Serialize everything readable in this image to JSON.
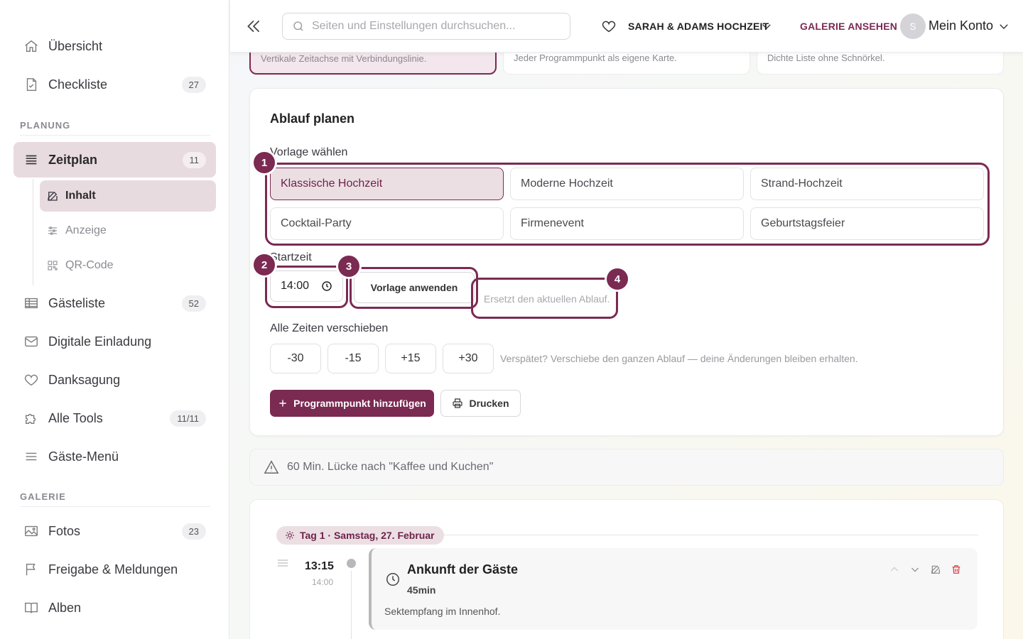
{
  "sidebar": {
    "items_top": [
      {
        "label": "Übersicht",
        "icon": "home-icon"
      },
      {
        "label": "Checkliste",
        "icon": "document-check-icon",
        "count": "27"
      }
    ],
    "section_planung": "PLANUNG",
    "zeitplan": {
      "label": "Zeitplan",
      "icon": "list-icon",
      "count": "11"
    },
    "sub_items": [
      {
        "label": "Inhalt",
        "icon": "edit-icon"
      },
      {
        "label": "Anzeige",
        "icon": "sliders-icon"
      },
      {
        "label": "QR-Code",
        "icon": "qr-code-icon"
      }
    ],
    "items_planung": [
      {
        "label": "Gästeliste",
        "icon": "table-icon",
        "count": "52"
      },
      {
        "label": "Digitale Einladung",
        "icon": "mail-icon"
      },
      {
        "label": "Danksagung",
        "icon": "heart-icon"
      },
      {
        "label": "Alle Tools",
        "icon": "puzzle-icon",
        "count": "11/11"
      },
      {
        "label": "Gäste-Menü",
        "icon": "menu-icon"
      }
    ],
    "section_galerie": "GALERIE",
    "items_galerie": [
      {
        "label": "Fotos",
        "icon": "image-icon",
        "count": "23"
      },
      {
        "label": "Freigabe & Meldungen",
        "icon": "flag-icon"
      },
      {
        "label": "Alben",
        "icon": "book-icon"
      }
    ]
  },
  "topbar": {
    "search_placeholder": "Seiten und Einstellungen durchsuchen...",
    "event_name": "SARAH & ADAMS HOCHZEIT",
    "gallery_link": "GALERIE ANSEHEN",
    "avatar_letter": "S",
    "account_label": "Mein Konto"
  },
  "layout_options": [
    {
      "text": "Vertikale Zeitachse mit Verbindungslinie.",
      "selected": true
    },
    {
      "text": "Jeder Programmpunkt als eigene Karte.",
      "selected": false
    },
    {
      "text": "Dichte Liste ohne Schnörkel.",
      "selected": false
    }
  ],
  "planner": {
    "title": "Ablauf planen",
    "template_label": "Vorlage wählen",
    "templates": [
      {
        "label": "Klassische Hochzeit",
        "selected": true
      },
      {
        "label": "Moderne Hochzeit",
        "selected": false
      },
      {
        "label": "Strand-Hochzeit",
        "selected": false
      },
      {
        "label": "Cocktail-Party",
        "selected": false
      },
      {
        "label": "Firmenevent",
        "selected": false
      },
      {
        "label": "Geburtstagsfeier",
        "selected": false
      }
    ],
    "start_label": "Startzeit",
    "start_time": "14:00",
    "apply_label": "Vorlage anwenden",
    "apply_hint": "Ersetzt den aktuellen Ablauf.",
    "shift_label": "Alle Zeiten verschieben",
    "shift_buttons": [
      "-30",
      "-15",
      "+15",
      "+30"
    ],
    "shift_hint": "Verspätet? Verschiebe den ganzen Ablauf — deine Änderungen bleiben erhalten.",
    "add_label": "Programmpunkt hinzufügen",
    "print_label": "Drucken"
  },
  "badges": [
    "1",
    "2",
    "3",
    "4"
  ],
  "warning": "60 Min. Lücke nach \"Kaffee und Kuchen\"",
  "timeline": {
    "day_label": "Tag 1 · Samstag, 27. Februar",
    "events": [
      {
        "time": "13:15",
        "original_time": "14:00",
        "title": "Ankunft der Gäste",
        "duration": "45min",
        "description": "Sektempfang im Innenhof."
      }
    ]
  },
  "colors": {
    "accent": "#7b2a52",
    "accent_light": "#ecdfe4",
    "danger": "#d33a3a"
  }
}
